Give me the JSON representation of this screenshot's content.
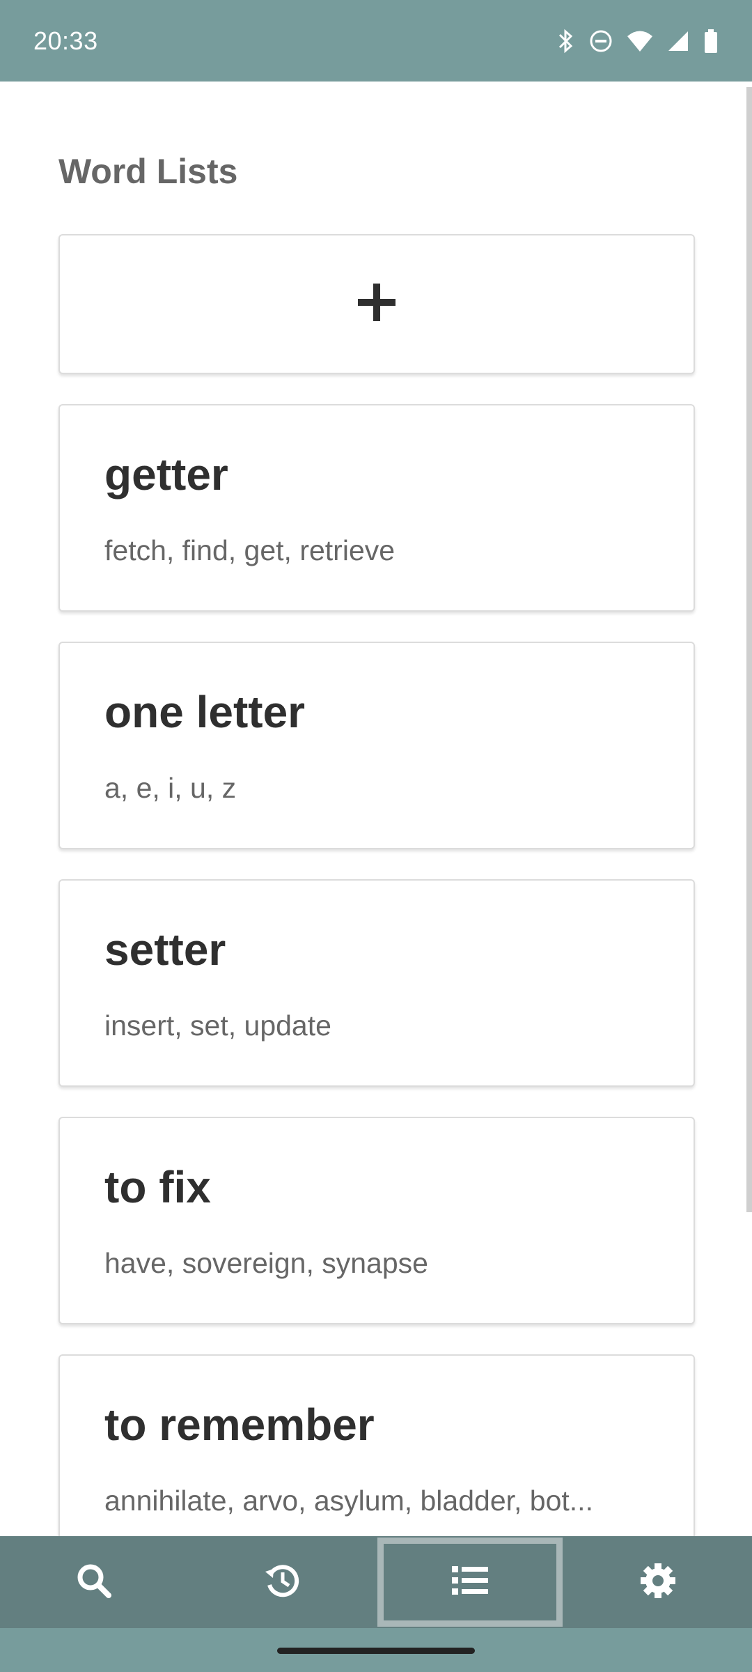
{
  "status_bar": {
    "time": "20:33",
    "icons": [
      "bluetooth-icon",
      "do-not-disturb-icon",
      "wifi-icon",
      "cell-signal-icon",
      "battery-icon"
    ]
  },
  "page": {
    "title": "Word Lists",
    "add_button_icon": "plus-icon"
  },
  "word_lists": [
    {
      "name": "getter",
      "words": "fetch, find, get, retrieve"
    },
    {
      "name": "one letter",
      "words": "a, e, i, u, z"
    },
    {
      "name": "setter",
      "words": "insert, set, update"
    },
    {
      "name": "to fix",
      "words": "have, sovereign, synapse"
    },
    {
      "name": "to remember",
      "words": "annihilate, arvo, asylum, bladder, bot..."
    }
  ],
  "bottom_nav": {
    "items": [
      {
        "icon": "search-icon",
        "active": false
      },
      {
        "icon": "history-icon",
        "active": false
      },
      {
        "icon": "list-icon",
        "active": true
      },
      {
        "icon": "settings-icon",
        "active": false
      }
    ]
  },
  "colors": {
    "status_bar": "#779c9c",
    "nav_bar": "#637f80",
    "active_outline": "#a9b7b8",
    "title_text": "#666666",
    "card_title": "#2f2f2f"
  }
}
